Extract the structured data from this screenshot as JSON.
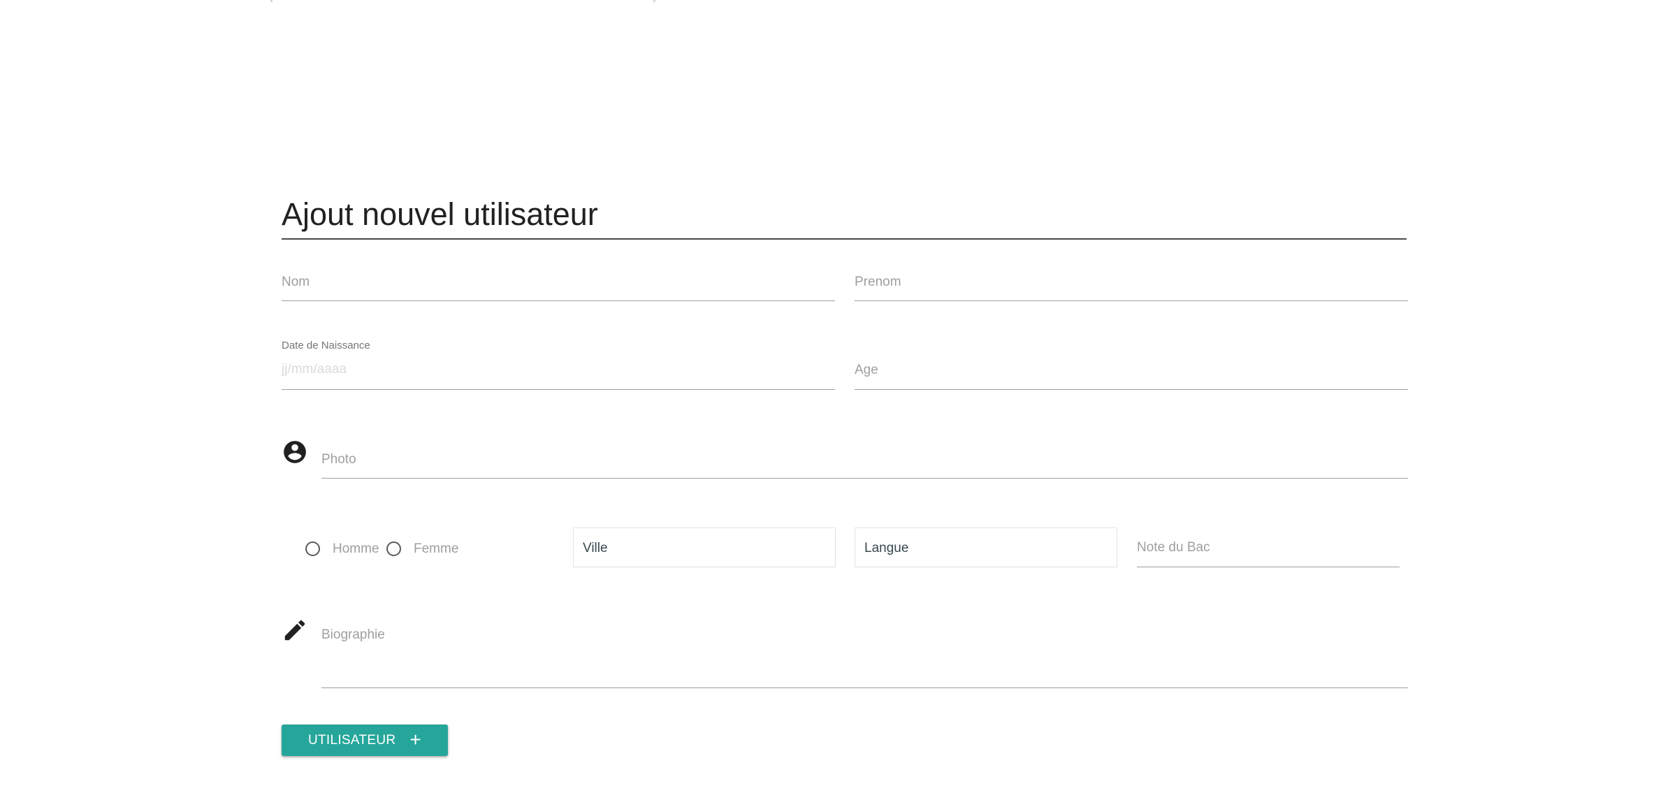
{
  "form": {
    "title": "Ajout nouvel utilisateur",
    "nom_label": "Nom",
    "prenom_label": "Prenom",
    "date_label": "Date de Naissance",
    "date_placeholder": "jj/mm/aaaa",
    "age_label": "Age",
    "photo_label": "Photo",
    "gender_options": [
      "Homme",
      "Femme"
    ],
    "ville_value": "Ville",
    "langue_value": "Langue",
    "note_label": "Note du Bac",
    "bio_label": "Biographie",
    "submit_label": "UTILISATEUR",
    "submit_icon": "+"
  },
  "icons": {
    "photo": "account-circle-icon",
    "bio": "pencil-icon"
  },
  "colors": {
    "accent": "#26a69a",
    "text": "#212121",
    "muted": "#9e9e9e"
  }
}
